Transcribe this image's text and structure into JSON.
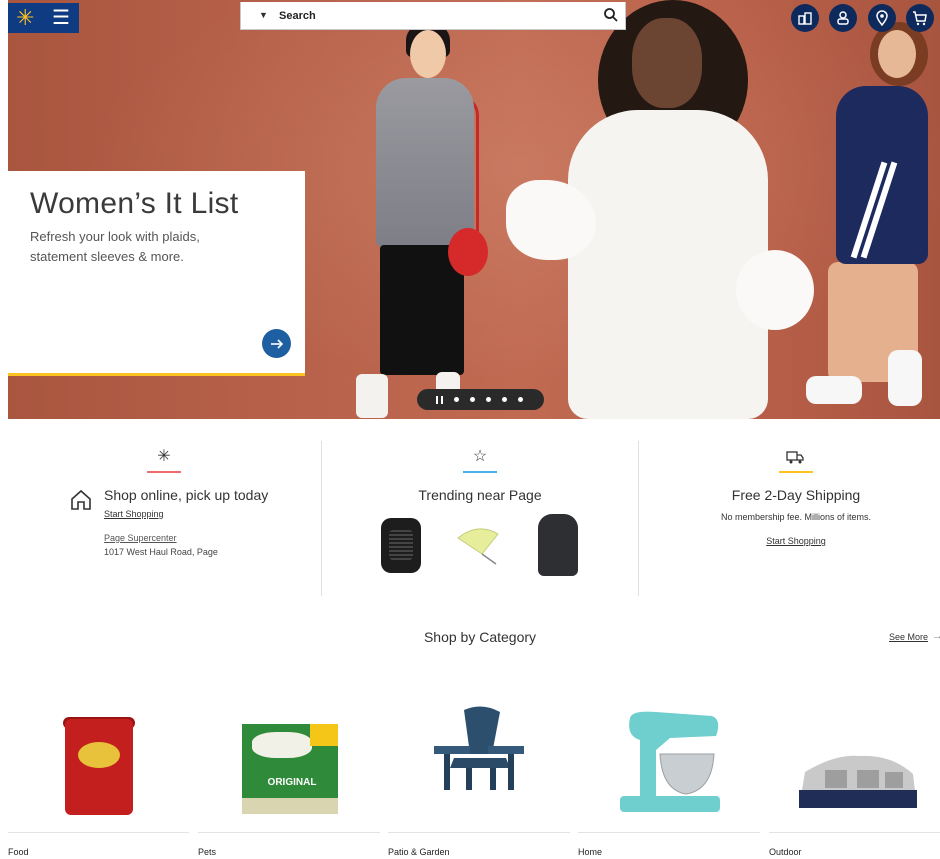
{
  "header": {
    "search_placeholder": "Search",
    "icons": [
      "spark-logo-icon",
      "menu-icon",
      "caret-down-icon",
      "search-icon",
      "reorder-icon",
      "account-icon",
      "location-icon",
      "cart-icon"
    ]
  },
  "hero": {
    "title": "Women’s It List",
    "subtitle": "Refresh your look with plaids, statement sleeves & more.",
    "carousel_dots": 5
  },
  "promos": {
    "pickup": {
      "title": "Shop online, pick up today",
      "link": "Start Shopping",
      "store": "Page Supercenter",
      "address": "1017 West Haul Road, Page"
    },
    "trending": {
      "title": "Trending near Page"
    },
    "shipping": {
      "title": "Free 2-Day Shipping",
      "subtitle": "No membership fee. Millions of items.",
      "link": "Start Shopping"
    }
  },
  "categories": {
    "title": "Shop by Category",
    "see_more": "See More",
    "items": [
      {
        "label": "Food"
      },
      {
        "label": "Pets"
      },
      {
        "label": "Patio & Garden"
      },
      {
        "label": "Home"
      },
      {
        "label": "Outdoor"
      }
    ],
    "greenies_badge": "ORIGINAL"
  },
  "colors": {
    "brand_blue": "#0e3b82",
    "spark_yellow": "#ffc220",
    "hero_bg": "#b7614a",
    "pickup_accent": "#f06b6b",
    "trending_accent": "#49b4e8",
    "shipping_accent": "#ffc220"
  }
}
